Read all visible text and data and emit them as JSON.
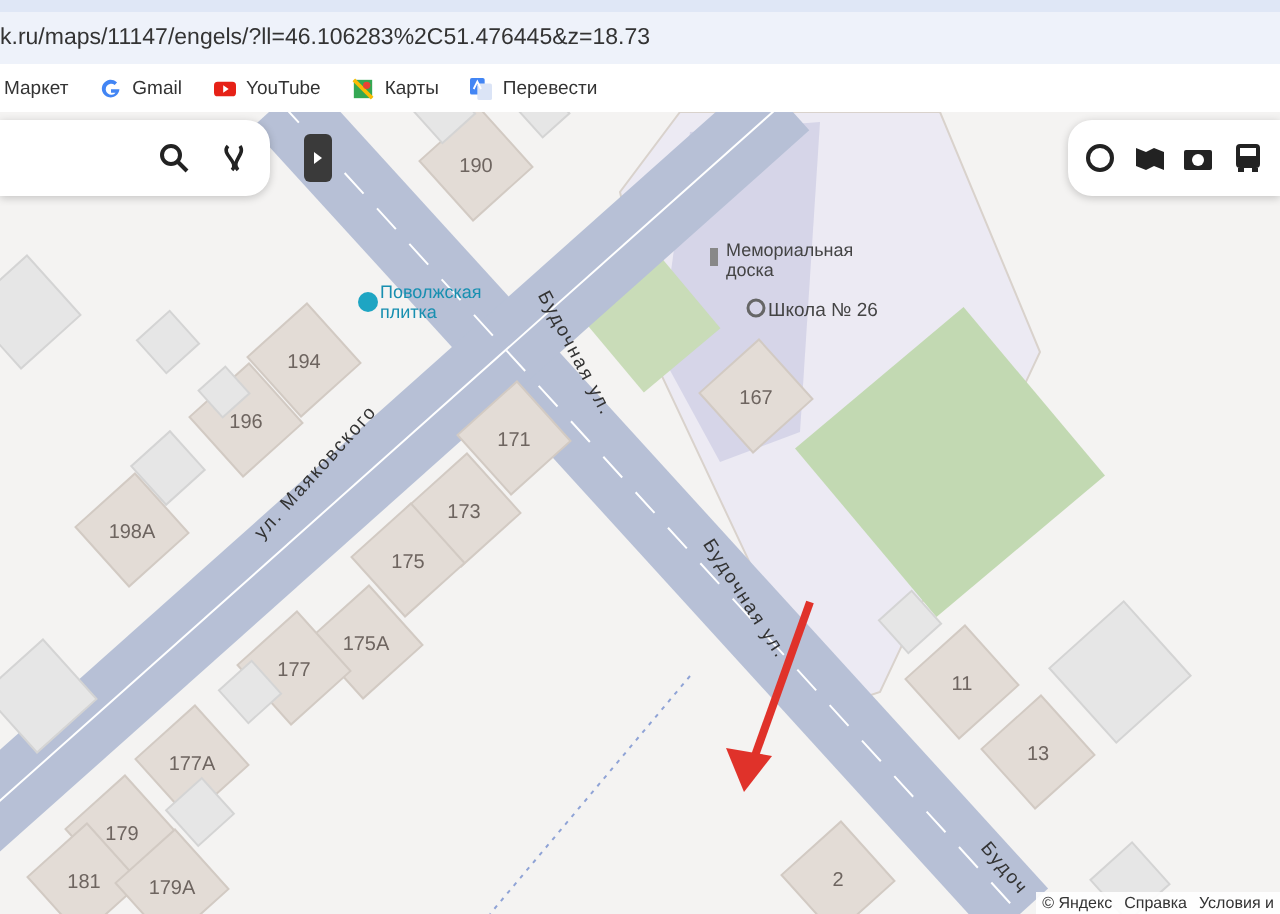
{
  "browser": {
    "url": "k.ru/maps/11147/engels/?ll=46.106283%2C51.476445&z=18.73",
    "bookmarks": [
      {
        "label": "Маркет",
        "kind": "plain"
      },
      {
        "label": "Gmail",
        "kind": "google"
      },
      {
        "label": "YouTube",
        "kind": "youtube"
      },
      {
        "label": "Карты",
        "kind": "maps"
      },
      {
        "label": "Перевести",
        "kind": "translate"
      }
    ]
  },
  "map": {
    "streets": [
      "ул. Маяковского",
      "Будочная ул.",
      "Будочная ул.",
      "Будоч"
    ],
    "places": [
      {
        "name": "Поволжская плитка",
        "kind": "shop"
      },
      {
        "name": "Мемориальная доска",
        "kind": "monument"
      },
      {
        "name": "Школа № 26",
        "kind": "school"
      }
    ],
    "house_numbers": [
      "190",
      "194",
      "196",
      "198А",
      "171",
      "173",
      "175",
      "175А",
      "177",
      "177А",
      "179",
      "181",
      "179А",
      "167",
      "11",
      "13",
      "2"
    ],
    "attribution": [
      "© Яндекс",
      "Справка",
      "Условия и"
    ]
  }
}
